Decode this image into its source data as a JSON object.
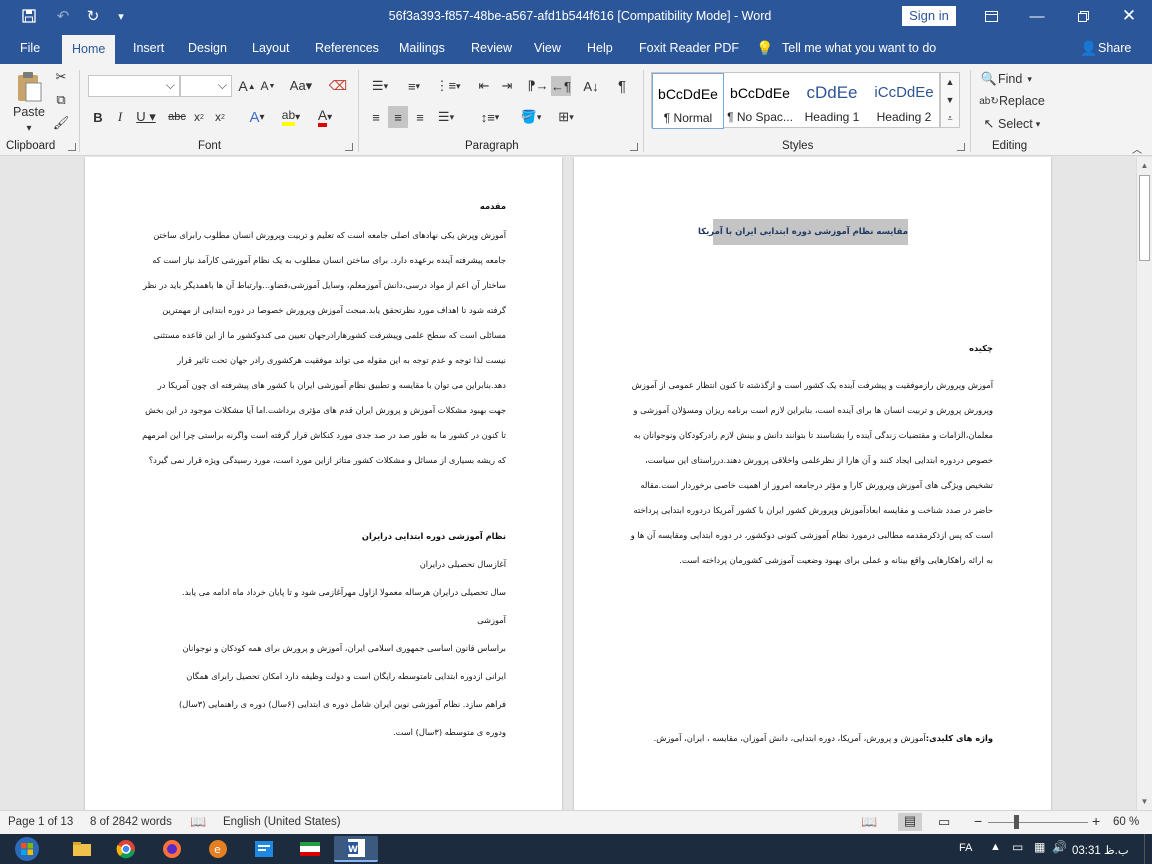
{
  "titlebar": {
    "title": "56f3a393-f857-48be-a567-afd1b544f616 [Compatibility Mode]  -  Word",
    "sign_in": "Sign in"
  },
  "tabs": [
    "File",
    "Home",
    "Insert",
    "Design",
    "Layout",
    "References",
    "Mailings",
    "Review",
    "View",
    "Help",
    "Foxit Reader PDF"
  ],
  "tell_me": "Tell me what you want to do",
  "share": "Share",
  "ribbon": {
    "clipboard": {
      "label": "Clipboard",
      "paste": "Paste"
    },
    "font": {
      "label": "Font",
      "font_name": "",
      "font_size": ""
    },
    "paragraph": {
      "label": "Paragraph"
    },
    "styles": {
      "label": "Styles",
      "items": [
        {
          "sample": "bCcDdEe",
          "name": "¶ Normal"
        },
        {
          "sample": "bCcDdEe",
          "name": "¶ No Spac..."
        },
        {
          "sample": "cDdEe",
          "name": "Heading 1"
        },
        {
          "sample": "iCcDdEe",
          "name": "Heading 2"
        }
      ]
    },
    "editing": {
      "label": "Editing",
      "find": "Find",
      "replace": "Replace",
      "select": "Select"
    }
  },
  "doc": {
    "right_page": {
      "title": "مقایسه نظام آموزشی دوره ابتدایی ایران با آمریکا",
      "abstract_heading": "چکیده",
      "abstract_lines": [
        "آموزش وپرورش رازموفقیت و پیشرفت آینده یک کشور است و ازگذشته تا کنون انتظار عمومی از آموزش",
        "وپرورش پرورش و تربیت انسان ها برای آینده است، بنابراین لازم است برنامه ریزان ومسؤلان آموزشی و",
        "معلمان،الزامات و مقتضیات زندگی آینده را بشناسند تا بتوانند دانش و بینش لازم رادرکودکان ونوجوانان به",
        "خصوص دردوره ابتدایی ایجاد کنند و آن هارا از نظرعلمی واخلاقی پرورش دهند.درراستای این سیاست،",
        "تشخیص ویژگی های آموزش وپرورش کارا و مؤثر درجامعه امروز از اهمیت خاصی برخوردار است.مقاله",
        "حاضر در صدد شناخت و مقایسه ابعادآموزش وپرورش کشور ایران با کشور آمریکا دردوره ابتدایی پرداخته",
        "است که پس ازذکرمقدمه مطالبی درمورد نظام آموزشی کنونی دوکشور، در دوره ابتدایی ومقایسه آن ها و",
        "به ارائه راهکارهایی واقع بینانه و عملی برای بهبود وضعیت آموزشی کشورمان پرداخته است."
      ],
      "keywords_label": "واژه های کلیدی:",
      "keywords": "آموزش و پرورش، آمریکا، دوره ابتدایی، دانش آموزان، مقایسه ، ایران، آموزش."
    },
    "left_page": {
      "intro_heading": "مقدمه",
      "intro_lines": [
        "آموزش وپرش یکی نهادهای اصلی جامعه است که تعلیم و تربیت وپرورش انسان مطلوب رابرای ساختن",
        "جامعه پیشرفته آینده برعهده دارد. برای ساختن انسان مطلوب به یک نظام آموزشی کارآمد نیاز است که",
        "ساختار آن اعم از مواد درسی،دانش آموزمعلم، وسایل آموزشی،فضاو...وارتباط آن ها باهمدیگر باید  در نظر",
        "گرفته شود تا اهداف مورد نظرتحقق یابد.مبحث آموزش وپرورش خصوصا در دوره ابتدایی از مهمترین",
        "مسائلی است که سطح علمی وپیشرفت کشورهارادرجهان تعیین می کندوکشور ما از این قاعده مستثنی",
        "نیست لذا توجه و عدم توجه به این مقوله می تواند موفقیت هرکشوری رادر جهان تحت تاثیر قرار",
        "دهد.بنابراین می توان با مقایسه و تطبیق نظام آموزشی ایران با کشور های پیشرفته ای چون آمریکا در",
        "جهت بهبود مشکلات آموزش و پرورش ایران قدم های مؤثری برداشت.اما آیا مشکلات موجود در این بخش",
        "تا کنون در کشور ما به طور صد در صد جدی مورد کنکاش قرار گرفته است واگرنه براستی چرا این امرمهم",
        "که ریشه بسیاری از مسائل و مشکلات کشور متاثر ازاین مورد است، مورد رسیدگی ویژه قرار نمی گیرد؟"
      ],
      "system_heading": "نظام آموزشی دوره ابتدایی درایران",
      "system_lines": [
        "آغازسال تحصیلی درایران",
        "سال تحصیلی درایران هرساله معمولا ازاول مهرآغازمی شود و تا پایان خرداد ماه ادامه می یابد.",
        "آموزشی",
        "براساس قانون اساسی جمهوری اسلامی ایران، آموزش و پرورش برای همه کودکان و نوجوانان",
        "ایرانی ازدوره ابتدایی تامتوسطه رایگان است و دولت وظیفه دارد امکان تحصیل رابرای همگان",
        "فراهم سازد. نظام آموزشی نوین ایران شامل دوره ی ابتدایی (۶سال) دوره ی راهنمایی (۳سال)",
        "ودوره ی متوسطه (۳سال) است."
      ]
    }
  },
  "status": {
    "page": "Page 1 of 13",
    "words": "8 of 2842 words",
    "language": "English (United States)",
    "zoom": "60 %"
  },
  "taskbar": {
    "lang": "FA",
    "time": "03:31 ب.ظ"
  },
  "colors": {
    "brand": "#2b579a",
    "title_highlight": "#c4c4c4",
    "title_text": "#1f3864"
  }
}
